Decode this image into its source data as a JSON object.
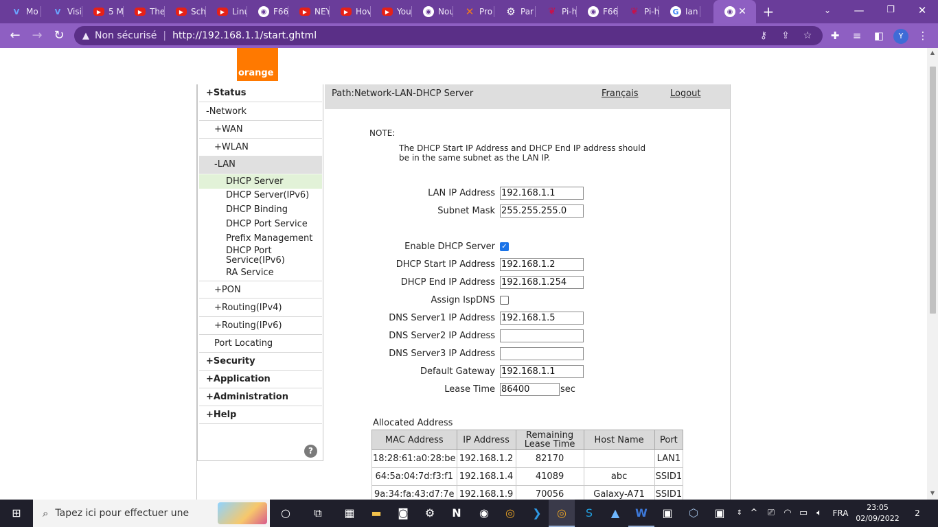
{
  "browser": {
    "tabs": [
      {
        "title": "Mo",
        "icon": "v-icon"
      },
      {
        "title": "Visi",
        "icon": "v-icon"
      },
      {
        "title": "5 M",
        "icon": "youtube-icon"
      },
      {
        "title": "The",
        "icon": "youtube-icon"
      },
      {
        "title": "Sch",
        "icon": "youtube-icon"
      },
      {
        "title": "Linu",
        "icon": "youtube-icon"
      },
      {
        "title": "F66",
        "icon": "chrome-icon"
      },
      {
        "title": "NEY",
        "icon": "youtube-icon"
      },
      {
        "title": "Hov",
        "icon": "youtube-icon"
      },
      {
        "title": "You",
        "icon": "youtube-icon"
      },
      {
        "title": "Nou",
        "icon": "chrome-icon"
      },
      {
        "title": "Pro",
        "icon": "x-icon"
      },
      {
        "title": "Par",
        "icon": "gear-icon"
      },
      {
        "title": "Pi-h",
        "icon": "raspberry-icon"
      },
      {
        "title": "F66",
        "icon": "chrome-icon"
      },
      {
        "title": "Pi-h",
        "icon": "raspberry-icon"
      },
      {
        "title": "Ian",
        "icon": "google-icon"
      },
      {
        "title": "",
        "icon": "chrome-icon",
        "active": true
      }
    ],
    "security_label": "Non sécurisé",
    "url": "http://192.168.1.1/start.ghtml",
    "profile_initial": "Y"
  },
  "router": {
    "logo_text": "orange",
    "path": "Path:Network-LAN-DHCP Server",
    "language_link": "Français",
    "logout_link": "Logout",
    "menu": {
      "status": "+Status",
      "network": "-Network",
      "wan": "+WAN",
      "wlan": "+WLAN",
      "lan": "-LAN",
      "lan_items": [
        "DHCP Server",
        "DHCP Server(IPv6)",
        "DHCP Binding",
        "DHCP Port Service",
        "Prefix Management",
        "DHCP Port Service(IPv6)",
        "RA Service"
      ],
      "pon": "+PON",
      "routing_ipv4": "+Routing(IPv4)",
      "routing_ipv6": "+Routing(IPv6)",
      "port_locating": "Port Locating",
      "security": "+Security",
      "application": "+Application",
      "administration": "+Administration",
      "help": "+Help",
      "help_button": "?"
    },
    "note_label": "NOTE:",
    "note_text": "The DHCP Start IP Address and DHCP End IP address should be in the same subnet as the LAN IP.",
    "form": {
      "lan_ip": {
        "label": "LAN IP Address",
        "value": "192.168.1.1"
      },
      "subnet_mask": {
        "label": "Subnet Mask",
        "value": "255.255.255.0"
      },
      "enable_dhcp": {
        "label": "Enable DHCP Server",
        "checked": true
      },
      "dhcp_start": {
        "label": "DHCP Start IP Address",
        "value": "192.168.1.2"
      },
      "dhcp_end": {
        "label": "DHCP End IP Address",
        "value": "192.168.1.254"
      },
      "assign_ispdns": {
        "label": "Assign IspDNS",
        "checked": false
      },
      "dns1": {
        "label": "DNS Server1 IP Address",
        "value": "192.168.1.5"
      },
      "dns2": {
        "label": "DNS Server2 IP Address",
        "value": ""
      },
      "dns3": {
        "label": "DNS Server3 IP Address",
        "value": ""
      },
      "gateway": {
        "label": "Default Gateway",
        "value": "192.168.1.1"
      },
      "lease_time": {
        "label": "Lease Time",
        "value": "86400",
        "unit": "sec"
      }
    },
    "allocated": {
      "title": "Allocated Address",
      "headers": [
        "MAC Address",
        "IP Address",
        "Remaining Lease Time",
        "Host Name",
        "Port"
      ],
      "rows": [
        [
          "18:28:61:a0:28:be",
          "192.168.1.2",
          "82170",
          "",
          "LAN1"
        ],
        [
          "64:5a:04:7d:f3:f1",
          "192.168.1.4",
          "41089",
          "abc",
          "SSID1"
        ],
        [
          "9a:34:fa:43:d7:7e",
          "192.168.1.9",
          "70056",
          "Galaxy-A71",
          "SSID1"
        ]
      ]
    }
  },
  "taskbar": {
    "search_placeholder": "Tapez ici pour effectuer une",
    "language": "FRA",
    "time": "23:05",
    "date": "02/09/2022",
    "notification_count": "2"
  }
}
